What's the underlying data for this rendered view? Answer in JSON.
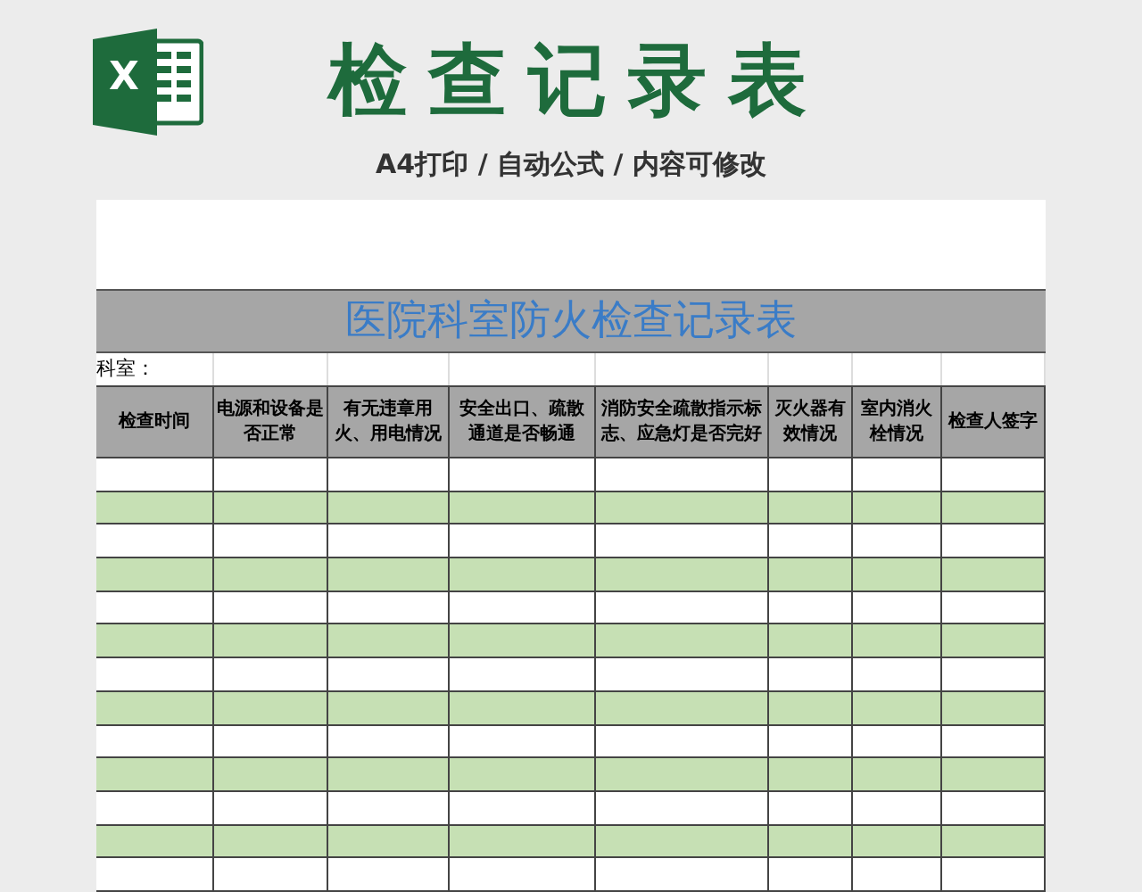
{
  "logo": {
    "letter": "X"
  },
  "title": "检查记录表",
  "subtitle": "A4打印 / 自动公式 / 内容可修改",
  "sheet": {
    "title": "医院科室防火检查记录表",
    "department_label": "科室：",
    "columns": [
      "检查时间",
      "电源和设备是否正常",
      "有无违章用火、用电情况",
      "安全出口、疏散通道是否畅通",
      "消防安全疏散指示标志、应急灯是否完好",
      "灭火器有效情况",
      "室内消火栓情况",
      "检查人签字"
    ]
  }
}
